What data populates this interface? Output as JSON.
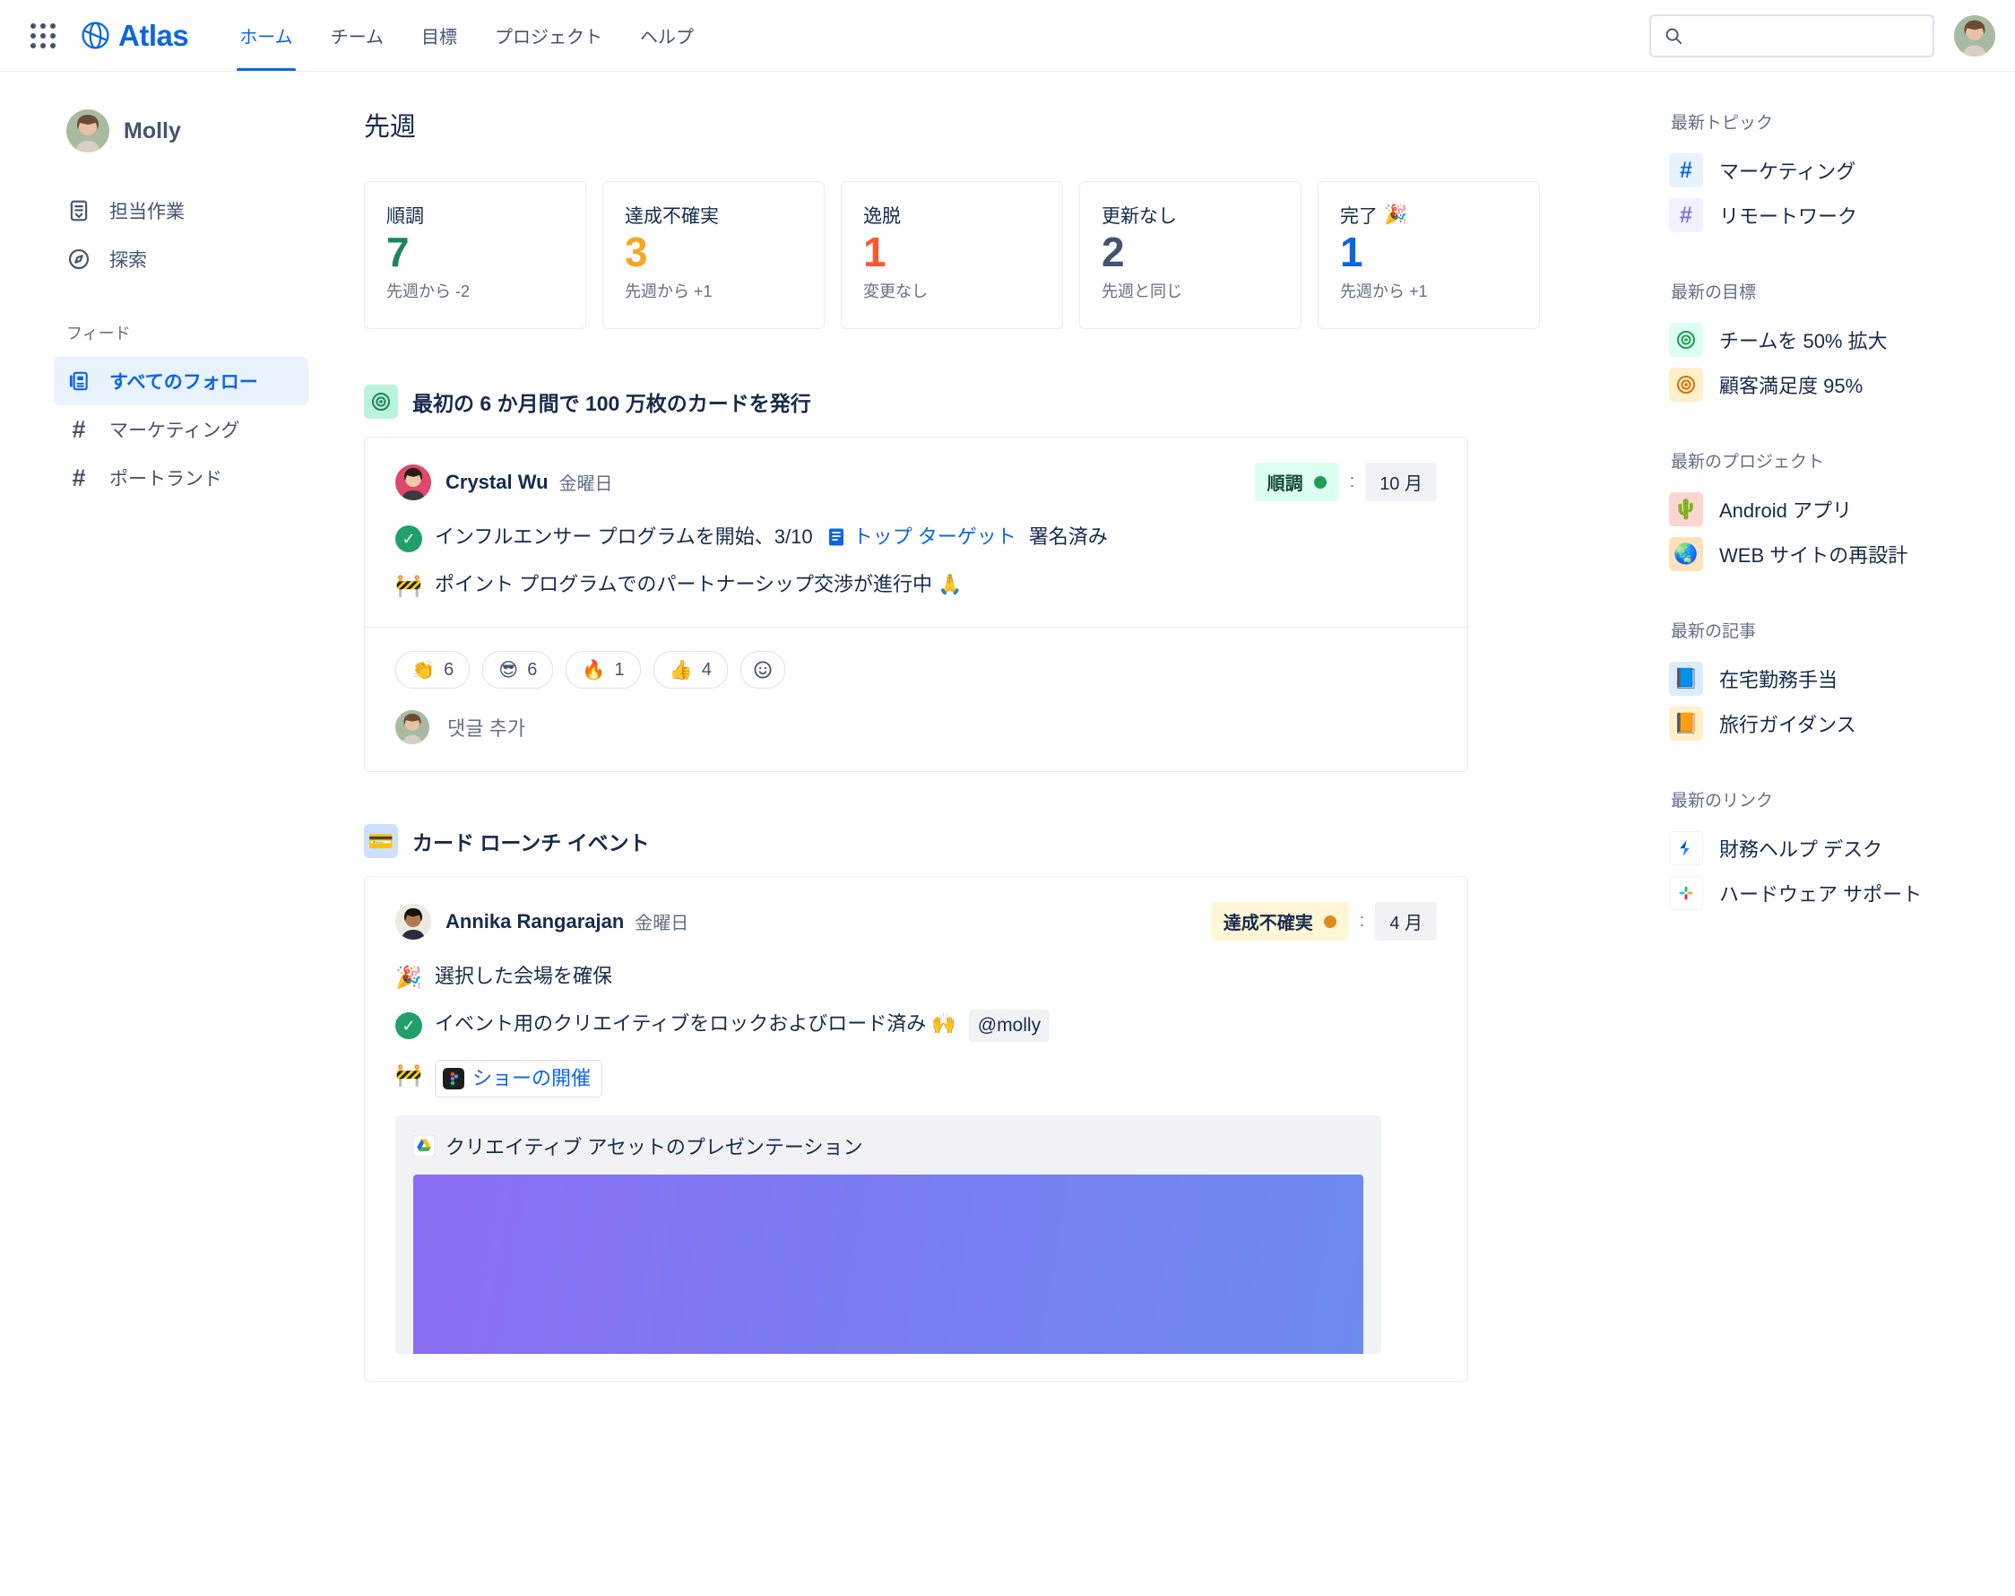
{
  "nav": {
    "brand": "Atlas",
    "links": [
      {
        "label": "ホーム",
        "active": true
      },
      {
        "label": "チーム",
        "active": false
      },
      {
        "label": "目標",
        "active": false
      },
      {
        "label": "プロジェクト",
        "active": false
      },
      {
        "label": "ヘルプ",
        "active": false
      }
    ],
    "search_value": "",
    "search_placeholder": ""
  },
  "sidebar": {
    "user_name": "Molly",
    "items": [
      {
        "label": "担当作業",
        "icon": "assigned-work-icon"
      },
      {
        "label": "探索",
        "icon": "compass-icon"
      }
    ],
    "feed_label": "フィード",
    "feed_items": [
      {
        "label": "すべてのフォロー",
        "icon": "feed-icon",
        "selected": true
      },
      {
        "label": "マーケティング",
        "icon": "hash-icon",
        "selected": false
      },
      {
        "label": "ポートランド",
        "icon": "hash-icon",
        "selected": false
      }
    ]
  },
  "main": {
    "page_title": "先週",
    "stats": [
      {
        "label": "順調",
        "emoji": "",
        "value": "7",
        "value_color": "#1F845A",
        "delta": "先週から -2"
      },
      {
        "label": "達成不確実",
        "emoji": "",
        "value": "3",
        "value_color": "#F5A623",
        "delta": "先週から +1"
      },
      {
        "label": "逸脱",
        "emoji": "",
        "value": "1",
        "value_color": "#FF5630",
        "delta": "変更なし"
      },
      {
        "label": "更新なし",
        "emoji": "",
        "value": "2",
        "value_color": "#44546F",
        "delta": "先週と同じ"
      },
      {
        "label": "完了",
        "emoji": "🎉",
        "value": "1",
        "value_color": "#0C66E4",
        "delta": "先週から +1"
      }
    ],
    "posts": [
      {
        "heading": "最初の 6 か月間で 100 万枚のカードを発行",
        "heading_icon": "goal-target-icon",
        "heading_icon_bg": "#BAF3DB",
        "author": "Crystal Wu",
        "date": "金曜日",
        "status_label": "順調",
        "status_bg": "#DCFFF1",
        "status_text_color": "#164B35",
        "status_dot_color": "#1F9D55",
        "separator": ":",
        "target_date": "10 月",
        "lines": [
          {
            "icon": "check-circle-icon",
            "before": "インフルエンサー プログラムを開始、3/10 ",
            "link_icon": "confluence-doc-icon",
            "link": "トップ ターゲット",
            "after": "署名済み"
          },
          {
            "icon": "construction-icon",
            "before": "ポイント プログラムでのパートナーシップ交渉が進行中 🙏",
            "link": "",
            "after": ""
          }
        ],
        "reactions": [
          {
            "emoji": "👏",
            "count": "6"
          },
          {
            "emoji": "😎",
            "count": "6"
          },
          {
            "emoji": "🔥",
            "count": "1"
          },
          {
            "emoji": "👍",
            "count": "4"
          }
        ],
        "add_reaction_icon": "add-reaction-icon",
        "comment_placeholder": "댓글 추가"
      },
      {
        "heading": "カード ローンチ イベント",
        "heading_icon": "credit-card-icon",
        "heading_icon_bg": "#CCE0FF",
        "author": "Annika Rangarajan",
        "date": "金曜日",
        "status_label": "達成不確実",
        "status_bg": "#FFF7D6",
        "status_text_color": "#172B4D",
        "status_dot_color": "#E2891C",
        "separator": ":",
        "target_date": "4 月",
        "lines": [
          {
            "icon": "party-popper-icon",
            "before": "選択した会場を確保",
            "link": "",
            "after": ""
          },
          {
            "icon": "check-circle-icon",
            "before": "イベント用のクリエイティブをロックおよびロード済み 🙌",
            "mention": "@molly",
            "link": "",
            "after": ""
          },
          {
            "icon": "construction-icon",
            "before": "",
            "figma_link": "ショーの開催",
            "link": "",
            "after": ""
          }
        ],
        "attachment": {
          "icon": "google-drive-icon",
          "title": "クリエイティブ アセットのプレゼンテーション"
        }
      }
    ]
  },
  "rightrail": {
    "groups": [
      {
        "title": "最新トピック",
        "items": [
          {
            "label": "マーケティング",
            "icon": "hash-icon",
            "bg": "#E9F2FF",
            "fg": "#0C66E4"
          },
          {
            "label": "リモートワーク",
            "icon": "hash-icon",
            "bg": "#F3F0FF",
            "fg": "#8270DB"
          }
        ]
      },
      {
        "title": "最新の目標",
        "items": [
          {
            "label": "チームを 50% 拡大",
            "icon": "goal-target-icon",
            "bg": "#DCFFF1",
            "fg": "#1F9D55"
          },
          {
            "label": "顧客満足度 95%",
            "icon": "goal-target-icon",
            "bg": "#FFF0C9",
            "fg": "#D97008"
          }
        ]
      },
      {
        "title": "最新のプロジェクト",
        "items": [
          {
            "label": "Android アプリ",
            "icon": "cactus-emoji",
            "emoji": "🌵",
            "bg": "#FFD5D2",
            "fg": "#172B4D"
          },
          {
            "label": "WEB サイトの再設計",
            "icon": "earth-emoji",
            "emoji": "🌏",
            "bg": "#FFE2BD",
            "fg": "#172B4D"
          }
        ]
      },
      {
        "title": "最新の記事",
        "items": [
          {
            "label": "在宅勤務手当",
            "icon": "blue-book-emoji",
            "emoji": "📘",
            "bg": "#DEEBFF",
            "fg": "#172B4D"
          },
          {
            "label": "旅行ガイダンス",
            "icon": "orange-book-emoji",
            "emoji": "📙",
            "bg": "#FFF0C9",
            "fg": "#172B4D"
          }
        ]
      },
      {
        "title": "最新のリンク",
        "items": [
          {
            "label": "財務ヘルプ デスク",
            "icon": "jira-service-management-icon",
            "bg": "#FFFFFF",
            "fg": "#0C66E4"
          },
          {
            "label": "ハードウェア サポート",
            "icon": "slack-icon",
            "bg": "#FFFFFF",
            "fg": "#172B4D"
          }
        ]
      }
    ]
  }
}
